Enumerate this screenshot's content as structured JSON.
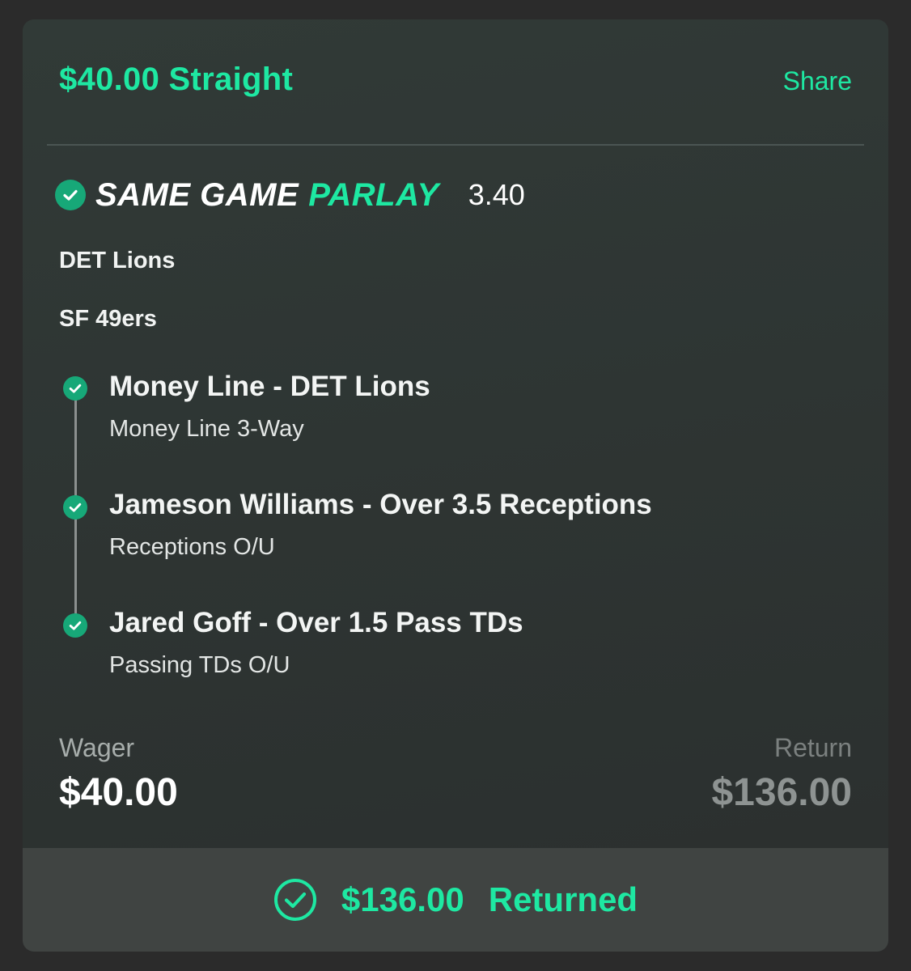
{
  "header": {
    "title": "$40.00 Straight",
    "share_label": "Share"
  },
  "parlay": {
    "label_prefix": "SAME GAME",
    "label_suffix": "PARLAY",
    "odds": "3.40",
    "status_icon": "check-circle-icon"
  },
  "teams": [
    "DET Lions",
    "SF 49ers"
  ],
  "legs": [
    {
      "title": "Money Line - DET Lions",
      "subtitle": "Money Line 3-Way",
      "status": "won"
    },
    {
      "title": "Jameson Williams - Over 3.5 Receptions",
      "subtitle": "Receptions O/U",
      "status": "won"
    },
    {
      "title": "Jared Goff - Over 1.5 Pass TDs",
      "subtitle": "Passing TDs O/U",
      "status": "won"
    }
  ],
  "wager": {
    "label": "Wager",
    "value": "$40.00"
  },
  "return": {
    "label": "Return",
    "value": "$136.00"
  },
  "footer": {
    "amount": "$136.00",
    "status_label": "Returned"
  },
  "colors": {
    "accent": "#1ee8a2",
    "check_fill": "#17a878",
    "card_bg": "#2f3634",
    "footer_bg": "#404442"
  }
}
